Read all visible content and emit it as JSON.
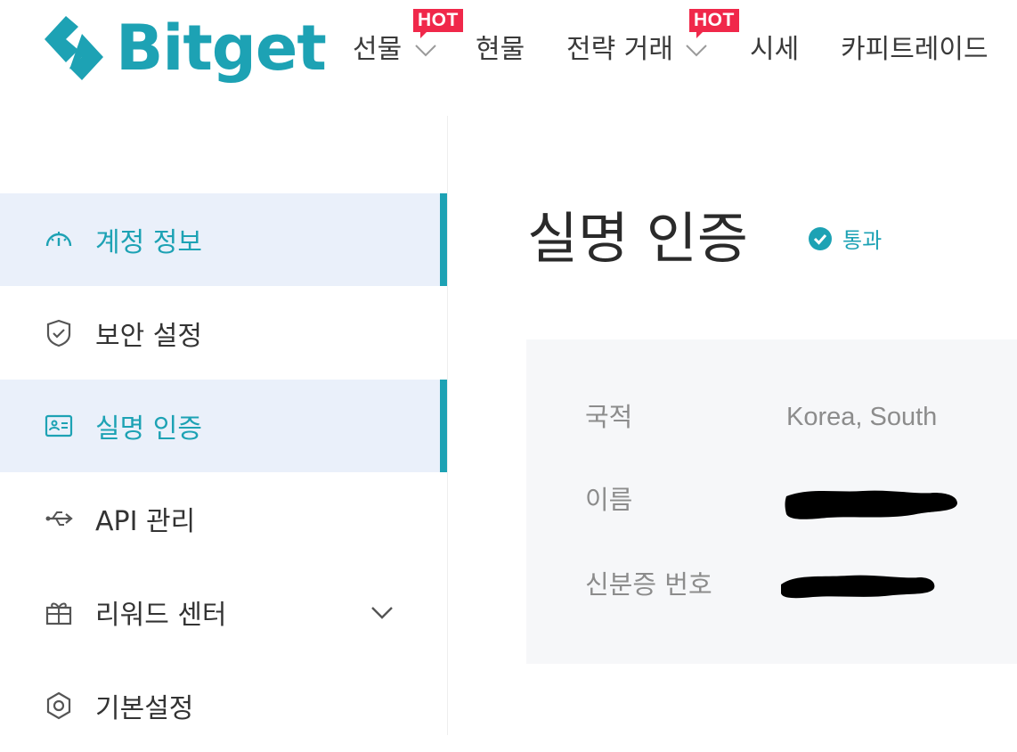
{
  "brand": {
    "name": "Bitget",
    "color": "#1DA2B4"
  },
  "nav": {
    "items": [
      {
        "label": "선물",
        "has_dropdown": true,
        "badge": "HOT"
      },
      {
        "label": "현물",
        "has_dropdown": false
      },
      {
        "label": "전략 거래",
        "has_dropdown": true,
        "badge": "HOT"
      },
      {
        "label": "시세",
        "has_dropdown": false
      },
      {
        "label": "카피트레이드",
        "has_dropdown": false
      }
    ]
  },
  "sidebar": {
    "items": [
      {
        "label": "계정 정보",
        "icon": "dashboard-icon",
        "active": true
      },
      {
        "label": "보안 설정",
        "icon": "shield-icon",
        "active": false
      },
      {
        "label": "실명 인증",
        "icon": "id-card-icon",
        "active": true
      },
      {
        "label": "API 관리",
        "icon": "usb-icon",
        "active": false
      },
      {
        "label": "리워드 센터",
        "icon": "gift-icon",
        "active": false,
        "expandable": true
      },
      {
        "label": "기본설정",
        "icon": "hexagon-settings-icon",
        "active": false
      }
    ]
  },
  "page": {
    "title": "실명 인증",
    "status": {
      "label": "통과",
      "icon": "check-circle-icon"
    }
  },
  "identity": {
    "rows": [
      {
        "label": "국적",
        "value": "Korea, South"
      },
      {
        "label": "이름",
        "value": "",
        "redacted": true
      },
      {
        "label": "신분증 번호",
        "value": "",
        "redacted": true
      }
    ]
  },
  "colors": {
    "accent": "#1DA2B4",
    "hot_badge": "#F0284A",
    "active_bg": "#EAF0FA",
    "card_bg": "#F6F7F9"
  }
}
